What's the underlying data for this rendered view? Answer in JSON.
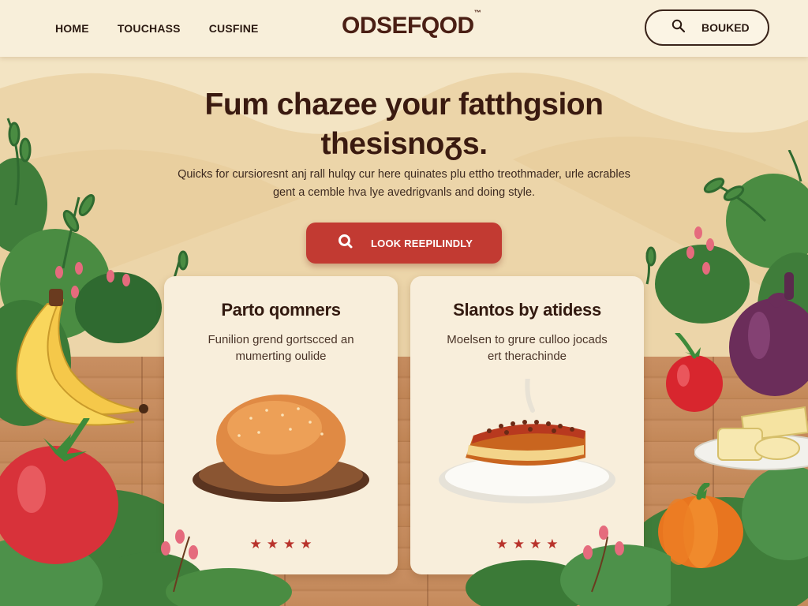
{
  "nav": {
    "items": [
      "HOME",
      "TOUCHASS",
      "CUSFINE"
    ]
  },
  "logo": {
    "text": "ODSEFQOD",
    "mark": "™"
  },
  "header_button": {
    "label": "BOUKED",
    "icon": "search-icon"
  },
  "hero": {
    "title_line1": "Fum chazee your fatthgsion",
    "title_line2": "thesisnoᵹs.",
    "subtitle_line1": "Quicks for cursioresnt anj rall hulqy cur here quinates plu ettho treothmader, urle acrables",
    "subtitle_line2": "gent a cemble hva lye avedrigvanls and doing style."
  },
  "cta": {
    "label": "LOOK REEPILINDLY",
    "icon": "search-icon"
  },
  "cards": [
    {
      "title": "Parto qomners",
      "desc_line1": "Funilion grend gortscced an",
      "desc_line2": "mumerting oulide",
      "image": "bread-bun-icon",
      "rating": 4
    },
    {
      "title": "Slantos by atidess",
      "desc_line1": "Moelsen to grure culloo jocads",
      "desc_line2": "ert therachinde",
      "image": "lasagna-plate-icon",
      "rating": 4
    }
  ],
  "colors": {
    "accent": "#c23a32",
    "header_bg": "#f8efda",
    "page_bg": "#f3e4c3",
    "card_bg": "#f8eedb",
    "text_dark": "#3a1a10"
  }
}
